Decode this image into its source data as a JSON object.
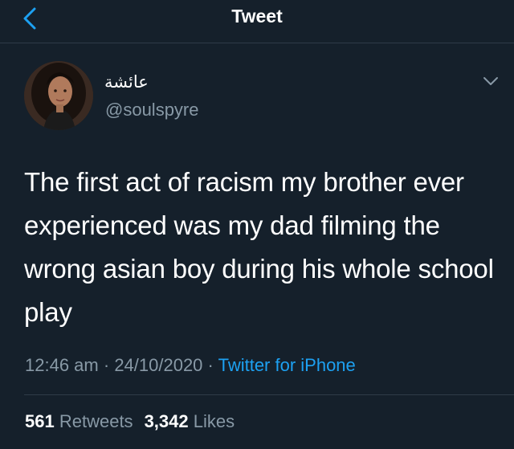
{
  "header": {
    "title": "Tweet",
    "back_icon": "chevron-left-icon",
    "accent_color": "#1da1f2"
  },
  "author": {
    "display_name": "عائشة",
    "handle": "@soulspyre",
    "menu_icon": "chevron-down-icon"
  },
  "tweet": {
    "text": "The first act of racism my brother ever experienced was my dad filming the wrong asian boy during his whole school play"
  },
  "meta": {
    "time": "12:46 am",
    "separator": "·",
    "date": "24/10/2020",
    "source": "Twitter for iPhone"
  },
  "stats": {
    "retweets_count": "561",
    "retweets_label": "Retweets",
    "likes_count": "3,342",
    "likes_label": "Likes"
  },
  "colors": {
    "background": "#15202b",
    "secondary_text": "#8899a6",
    "link": "#1da1f2",
    "divider": "#2f3b48"
  }
}
